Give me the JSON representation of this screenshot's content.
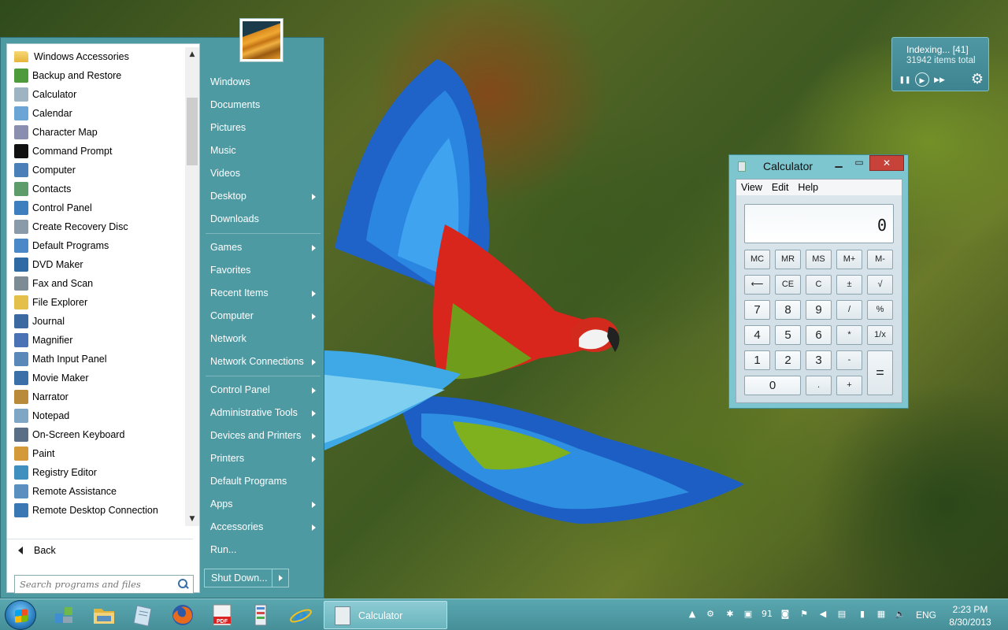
{
  "start_menu": {
    "programs": [
      {
        "label": "Windows Accessories",
        "icon": "folder-icon",
        "color": "#e6b43b"
      },
      {
        "label": "Backup and Restore",
        "icon": "backup-icon",
        "color": "#4d9b3a"
      },
      {
        "label": "Calculator",
        "icon": "calculator-icon",
        "color": "#9fb4c2"
      },
      {
        "label": "Calendar",
        "icon": "calendar-icon",
        "color": "#6aa5d6"
      },
      {
        "label": "Character Map",
        "icon": "character-map-icon",
        "color": "#8a8fb0"
      },
      {
        "label": "Command Prompt",
        "icon": "command-prompt-icon",
        "color": "#111111"
      },
      {
        "label": "Computer",
        "icon": "computer-icon",
        "color": "#4a7fb8"
      },
      {
        "label": "Contacts",
        "icon": "contacts-icon",
        "color": "#5f9c6b"
      },
      {
        "label": "Control Panel",
        "icon": "control-panel-icon",
        "color": "#3d7fbf"
      },
      {
        "label": "Create Recovery Disc",
        "icon": "recovery-disc-icon",
        "color": "#8a9aa8"
      },
      {
        "label": "Default Programs",
        "icon": "default-programs-icon",
        "color": "#4a88c7"
      },
      {
        "label": "DVD Maker",
        "icon": "dvd-maker-icon",
        "color": "#2f6aa5"
      },
      {
        "label": "Fax and Scan",
        "icon": "fax-scan-icon",
        "color": "#7d8b95"
      },
      {
        "label": "File Explorer",
        "icon": "file-explorer-icon",
        "color": "#e4c04a"
      },
      {
        "label": "Journal",
        "icon": "journal-icon",
        "color": "#3a6aa0"
      },
      {
        "label": "Magnifier",
        "icon": "magnifier-icon",
        "color": "#4a72b5"
      },
      {
        "label": "Math Input Panel",
        "icon": "math-input-icon",
        "color": "#5a88b8"
      },
      {
        "label": "Movie Maker",
        "icon": "movie-maker-icon",
        "color": "#3b6fa8"
      },
      {
        "label": "Narrator",
        "icon": "narrator-icon",
        "color": "#b88a3a"
      },
      {
        "label": "Notepad",
        "icon": "notepad-icon",
        "color": "#7fa6c4"
      },
      {
        "label": "On-Screen Keyboard",
        "icon": "keyboard-icon",
        "color": "#5a6f85"
      },
      {
        "label": "Paint",
        "icon": "paint-icon",
        "color": "#d49a3a"
      },
      {
        "label": "Registry Editor",
        "icon": "registry-editor-icon",
        "color": "#3f8fbf"
      },
      {
        "label": "Remote Assistance",
        "icon": "remote-assistance-icon",
        "color": "#5a8fc0"
      },
      {
        "label": "Remote Desktop Connection",
        "icon": "remote-desktop-icon",
        "color": "#3a78b5"
      }
    ],
    "back_label": "Back",
    "search_placeholder": "Search programs and files",
    "places": [
      {
        "label": "Windows",
        "submenu": false
      },
      {
        "label": "Documents",
        "submenu": false
      },
      {
        "label": "Pictures",
        "submenu": false
      },
      {
        "label": "Music",
        "submenu": false
      },
      {
        "label": "Videos",
        "submenu": false
      },
      {
        "label": "Desktop",
        "submenu": true
      },
      {
        "label": "Downloads",
        "submenu": false
      },
      {
        "label": "Games",
        "submenu": true,
        "sep_before": true
      },
      {
        "label": "Favorites",
        "submenu": false
      },
      {
        "label": "Recent Items",
        "submenu": true
      },
      {
        "label": "Computer",
        "submenu": true
      },
      {
        "label": "Network",
        "submenu": false
      },
      {
        "label": "Network Connections",
        "submenu": true
      },
      {
        "label": "Control Panel",
        "submenu": true,
        "sep_before": true
      },
      {
        "label": "Administrative Tools",
        "submenu": true
      },
      {
        "label": "Devices and Printers",
        "submenu": true
      },
      {
        "label": "Printers",
        "submenu": true
      },
      {
        "label": "Default Programs",
        "submenu": false
      },
      {
        "label": "Apps",
        "submenu": true
      },
      {
        "label": "Accessories",
        "submenu": true
      },
      {
        "label": "Run...",
        "submenu": false
      }
    ],
    "shutdown_label": "Shut Down..."
  },
  "indexing": {
    "status": "Indexing... [41]",
    "total": "31942 items total"
  },
  "calculator": {
    "title": "Calculator",
    "menu": [
      "View",
      "Edit",
      "Help"
    ],
    "display": "0",
    "keys": [
      {
        "label": "MC",
        "name": "mc"
      },
      {
        "label": "MR",
        "name": "mr"
      },
      {
        "label": "MS",
        "name": "ms"
      },
      {
        "label": "M+",
        "name": "m-plus"
      },
      {
        "label": "M-",
        "name": "m-minus"
      },
      {
        "label": "⟵",
        "name": "backspace"
      },
      {
        "label": "CE",
        "name": "ce"
      },
      {
        "label": "C",
        "name": "c"
      },
      {
        "label": "±",
        "name": "negate"
      },
      {
        "label": "√",
        "name": "sqrt"
      },
      {
        "label": "7",
        "name": "7",
        "num": true
      },
      {
        "label": "8",
        "name": "8",
        "num": true
      },
      {
        "label": "9",
        "name": "9",
        "num": true
      },
      {
        "label": "/",
        "name": "divide"
      },
      {
        "label": "%",
        "name": "percent"
      },
      {
        "label": "4",
        "name": "4",
        "num": true
      },
      {
        "label": "5",
        "name": "5",
        "num": true
      },
      {
        "label": "6",
        "name": "6",
        "num": true
      },
      {
        "label": "*",
        "name": "multiply"
      },
      {
        "label": "1/x",
        "name": "reciprocal"
      },
      {
        "label": "1",
        "name": "1",
        "num": true
      },
      {
        "label": "2",
        "name": "2",
        "num": true
      },
      {
        "label": "3",
        "name": "3",
        "num": true
      },
      {
        "label": "-",
        "name": "subtract"
      },
      {
        "label": "=",
        "name": "equals"
      },
      {
        "label": "0",
        "name": "0",
        "num": true
      },
      {
        "label": ".",
        "name": "decimal"
      },
      {
        "label": "+",
        "name": "add"
      }
    ]
  },
  "taskbar": {
    "pinned": [
      "start-orb",
      "network-tools-icon",
      "file-explorer-icon",
      "notepad-icon",
      "firefox-icon",
      "pdf-icon",
      "task-manager-icon",
      "internet-explorer-icon"
    ],
    "running_label": "Calculator",
    "tray_temp": "91",
    "language": "ENG",
    "time": "2:23 PM",
    "date": "8/30/2013"
  },
  "colors": {
    "start_menu_bg": "#4d9aa3",
    "taskbar_bg": "#4e9aa4",
    "calc_frame": "#7ec6cf",
    "close_button": "#c7433a"
  }
}
